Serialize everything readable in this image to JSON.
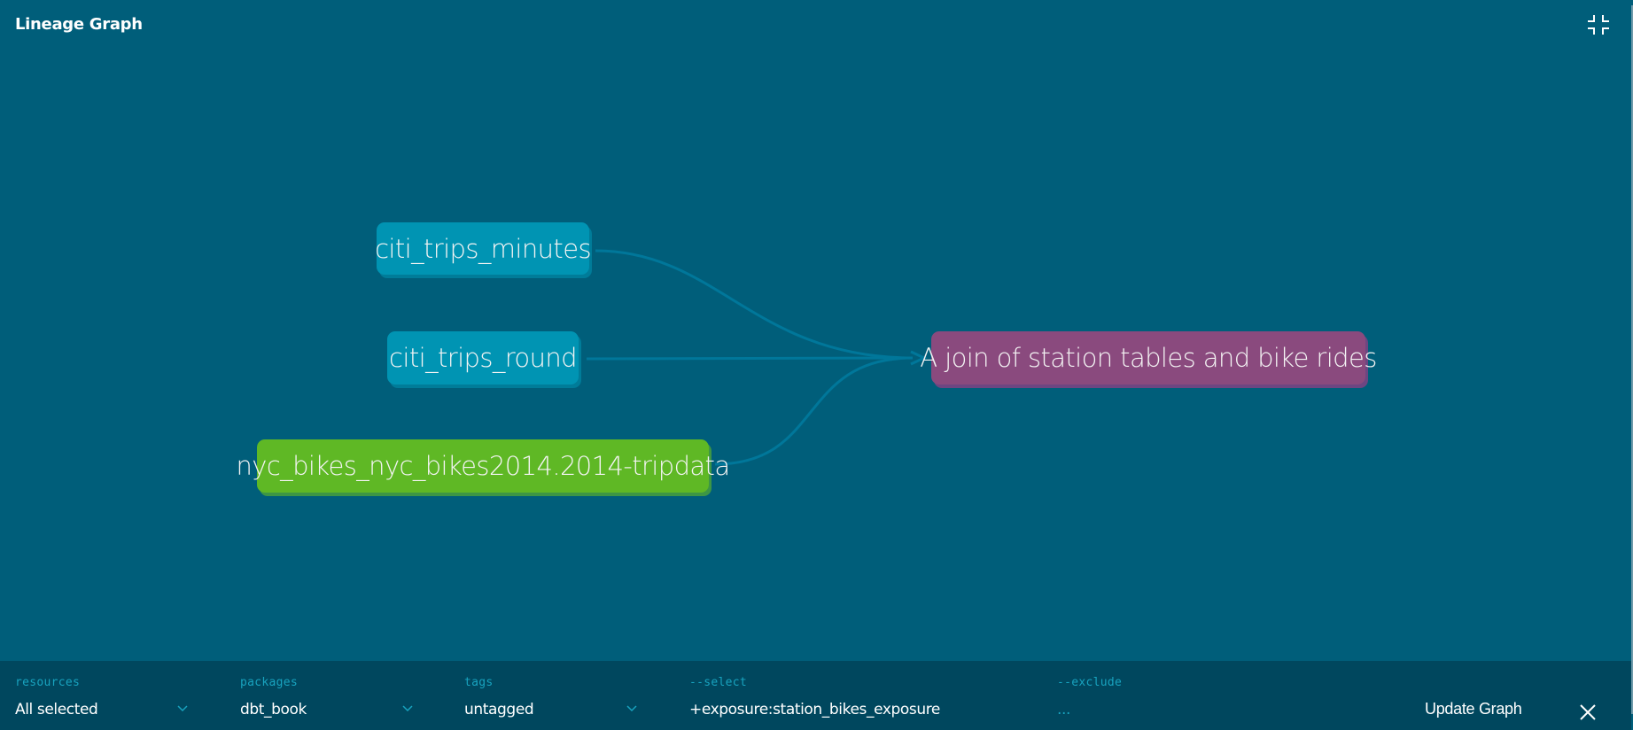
{
  "header": {
    "title": "Lineage Graph",
    "collapse_icon": "collapse-fullscreen-icon"
  },
  "graph": {
    "nodes": [
      {
        "id": "citi_trips_minutes",
        "label": "citi_trips_minutes",
        "type": "model",
        "color": "#0094b3"
      },
      {
        "id": "citi_trips_round",
        "label": "citi_trips_round",
        "type": "model",
        "color": "#0094b3"
      },
      {
        "id": "nyc_bikes",
        "label": "nyc_bikes_nyc_bikes2014.2014-tripdata",
        "type": "source",
        "color": "#5fb825"
      },
      {
        "id": "station_bikes_exposure",
        "label": "A join of station tables and bike rides",
        "type": "exposure",
        "color": "#8a4a7e"
      }
    ],
    "edges": [
      {
        "from": "citi_trips_minutes",
        "to": "station_bikes_exposure"
      },
      {
        "from": "citi_trips_round",
        "to": "station_bikes_exposure"
      },
      {
        "from": "nyc_bikes",
        "to": "station_bikes_exposure"
      }
    ],
    "edge_color": "#00779a"
  },
  "filters": {
    "resources": {
      "label": "resources",
      "value": "All selected"
    },
    "packages": {
      "label": "packages",
      "value": "dbt_book"
    },
    "tags": {
      "label": "tags",
      "value": "untagged"
    },
    "select": {
      "label": "--select",
      "value": "+exposure:station_bikes_exposure"
    },
    "exclude": {
      "label": "--exclude",
      "placeholder": "..."
    },
    "update_label": "Update Graph",
    "close_icon": "close-icon"
  }
}
